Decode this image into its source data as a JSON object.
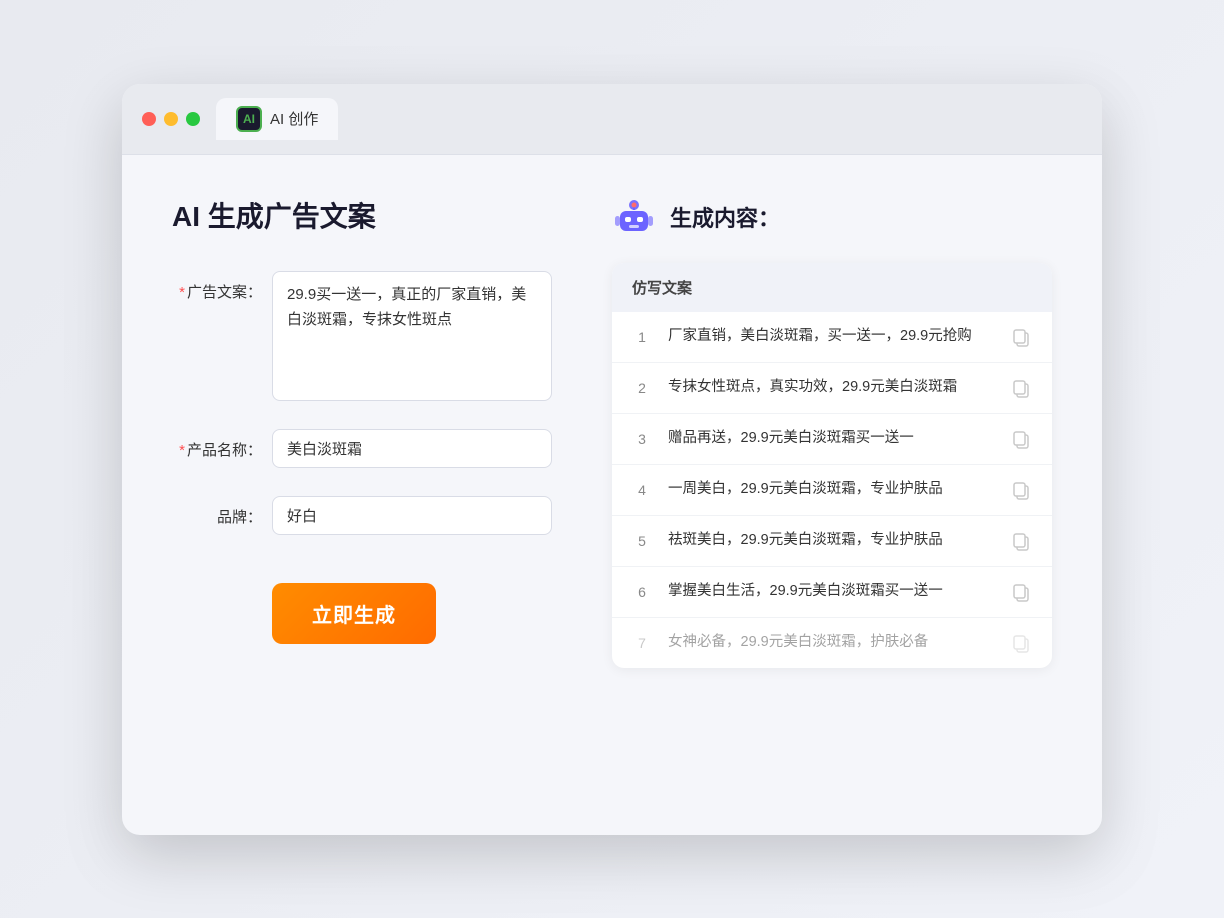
{
  "browser": {
    "tab_label": "AI 创作",
    "ai_logo_text": "AI"
  },
  "left": {
    "page_title": "AI 生成广告文案",
    "fields": [
      {
        "id": "ad_copy",
        "label": "广告文案：",
        "required": true,
        "type": "textarea",
        "value": "29.9买一送一，真正的厂家直销，美白淡斑霜，专抹女性斑点"
      },
      {
        "id": "product_name",
        "label": "产品名称：",
        "required": true,
        "type": "input",
        "value": "美白淡斑霜"
      },
      {
        "id": "brand",
        "label": "品牌：",
        "required": false,
        "type": "input",
        "value": "好白"
      }
    ],
    "generate_button": "立即生成"
  },
  "right": {
    "title": "生成内容：",
    "results_header": "仿写文案",
    "results": [
      {
        "num": "1",
        "text": "厂家直销，美白淡斑霜，买一送一，29.9元抢购",
        "faded": false
      },
      {
        "num": "2",
        "text": "专抹女性斑点，真实功效，29.9元美白淡斑霜",
        "faded": false
      },
      {
        "num": "3",
        "text": "赠品再送，29.9元美白淡斑霜买一送一",
        "faded": false
      },
      {
        "num": "4",
        "text": "一周美白，29.9元美白淡斑霜，专业护肤品",
        "faded": false
      },
      {
        "num": "5",
        "text": "祛斑美白，29.9元美白淡斑霜，专业护肤品",
        "faded": false
      },
      {
        "num": "6",
        "text": "掌握美白生活，29.9元美白淡斑霜买一送一",
        "faded": false
      },
      {
        "num": "7",
        "text": "女神必备，29.9元美白淡斑霜，护肤必备",
        "faded": true
      }
    ]
  }
}
